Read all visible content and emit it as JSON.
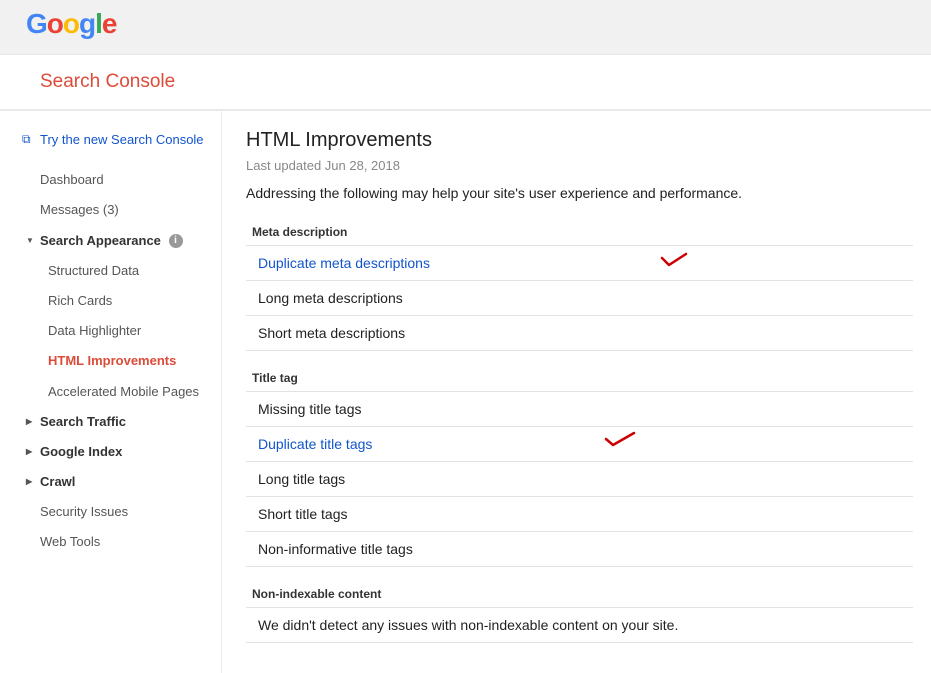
{
  "logo": {
    "title": "Google"
  },
  "brand": "Search Console",
  "sidebar": {
    "tryNew": "Try the new Search Console",
    "dashboard": "Dashboard",
    "messages": "Messages (3)",
    "searchAppearance": "Search Appearance",
    "structuredData": "Structured Data",
    "richCards": "Rich Cards",
    "dataHighlighter": "Data Highlighter",
    "htmlImprovements": "HTML Improvements",
    "amp": "Accelerated Mobile Pages",
    "searchTraffic": "Search Traffic",
    "googleIndex": "Google Index",
    "crawl": "Crawl",
    "securityIssues": "Security Issues",
    "webTools": "Web Tools"
  },
  "main": {
    "title": "HTML Improvements",
    "updated": "Last updated Jun 28, 2018",
    "intro": "Addressing the following may help your site's user experience and performance.",
    "metaHead": "Meta description",
    "meta1": "Duplicate meta descriptions",
    "meta2": "Long meta descriptions",
    "meta3": "Short meta descriptions",
    "titleHead": "Title tag",
    "title1": "Missing title tags",
    "title2": "Duplicate title tags",
    "title3": "Long title tags",
    "title4": "Short title tags",
    "title5": "Non-informative title tags",
    "nonIndexHead": "Non-indexable content",
    "nonIndexMsg": "We didn't detect any issues with non-indexable content on your site."
  }
}
